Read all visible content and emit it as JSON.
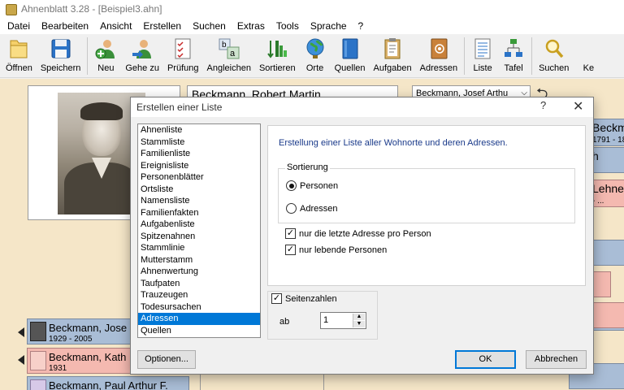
{
  "window": {
    "title": "Ahnenblatt 3.28 - [Beispiel3.ahn]"
  },
  "menu": [
    "Datei",
    "Bearbeiten",
    "Ansicht",
    "Erstellen",
    "Suchen",
    "Extras",
    "Tools",
    "Sprache",
    "?"
  ],
  "toolbar": {
    "buttons": [
      {
        "label": "Öffnen",
        "icon": "folder-icon"
      },
      {
        "label": "Speichern",
        "icon": "floppy-disk-icon"
      },
      {
        "label": "Neu",
        "icon": "add-person-icon"
      },
      {
        "label": "Gehe zu",
        "icon": "go-to-person-icon"
      },
      {
        "label": "Prüfung",
        "icon": "checklist-icon"
      },
      {
        "label": "Angleichen",
        "icon": "match-icon"
      },
      {
        "label": "Sortieren",
        "icon": "sort-icon"
      },
      {
        "label": "Orte",
        "icon": "globe-icon"
      },
      {
        "label": "Quellen",
        "icon": "book-icon"
      },
      {
        "label": "Aufgaben",
        "icon": "clipboard-icon"
      },
      {
        "label": "Adressen",
        "icon": "address-book-icon"
      },
      {
        "label": "Liste",
        "icon": "list-icon"
      },
      {
        "label": "Tafel",
        "icon": "tree-chart-icon"
      },
      {
        "label": "Suchen",
        "icon": "magnifier-icon"
      },
      {
        "label": "Ke",
        "icon": ""
      }
    ]
  },
  "main": {
    "selected_person": "Beckmann, Robert Martin",
    "selector_value": "Beckmann, Josef Arthu",
    "left_cards": [
      {
        "name": "Beckmann, Jose",
        "dates": "1929 - 2005",
        "gender": "male"
      },
      {
        "name": "Beckmann, Kath",
        "dates": "1931",
        "gender": "female"
      },
      {
        "name": "Beckmann, Paul Arthur F.",
        "dates": "",
        "gender": "male"
      }
    ],
    "right_cards": [
      {
        "name": "Beckm",
        "dates": "1791 - 18"
      },
      {
        "name": "h",
        "dates": ""
      },
      {
        "name": "Lehner",
        "dates": "- ..."
      }
    ]
  },
  "dialog": {
    "title": "Erstellen einer Liste",
    "help": "?",
    "close": "✕",
    "list": [
      "Ahnenliste",
      "Stammliste",
      "Familienliste",
      "Ereignisliste",
      "Personenblätter",
      "Ortsliste",
      "Namensliste",
      "Familienfakten",
      "Aufgabenliste",
      "Spitzenahnen",
      "Stammlinie",
      "Mutterstamm",
      "Ahnenwertung",
      "Taufpaten",
      "Trauzeugen",
      "Todesursachen",
      "Adressen",
      "Quellen"
    ],
    "selected_index": 16,
    "description": "Erstellung einer Liste aller Wohnorte und deren Adressen.",
    "sort": {
      "legend": "Sortierung",
      "options": [
        "Personen",
        "Adressen"
      ],
      "selected": "Personen"
    },
    "checkboxes": [
      {
        "label": "nur die letzte Adresse pro Person",
        "checked": true
      },
      {
        "label": "nur lebende Personen",
        "checked": true
      }
    ],
    "page_numbers": {
      "label": "Seitenzahlen",
      "checked": true,
      "from_label": "ab",
      "from_value": "1"
    },
    "buttons": {
      "options": "Optionen...",
      "ok": "OK",
      "cancel": "Abbrechen"
    }
  }
}
